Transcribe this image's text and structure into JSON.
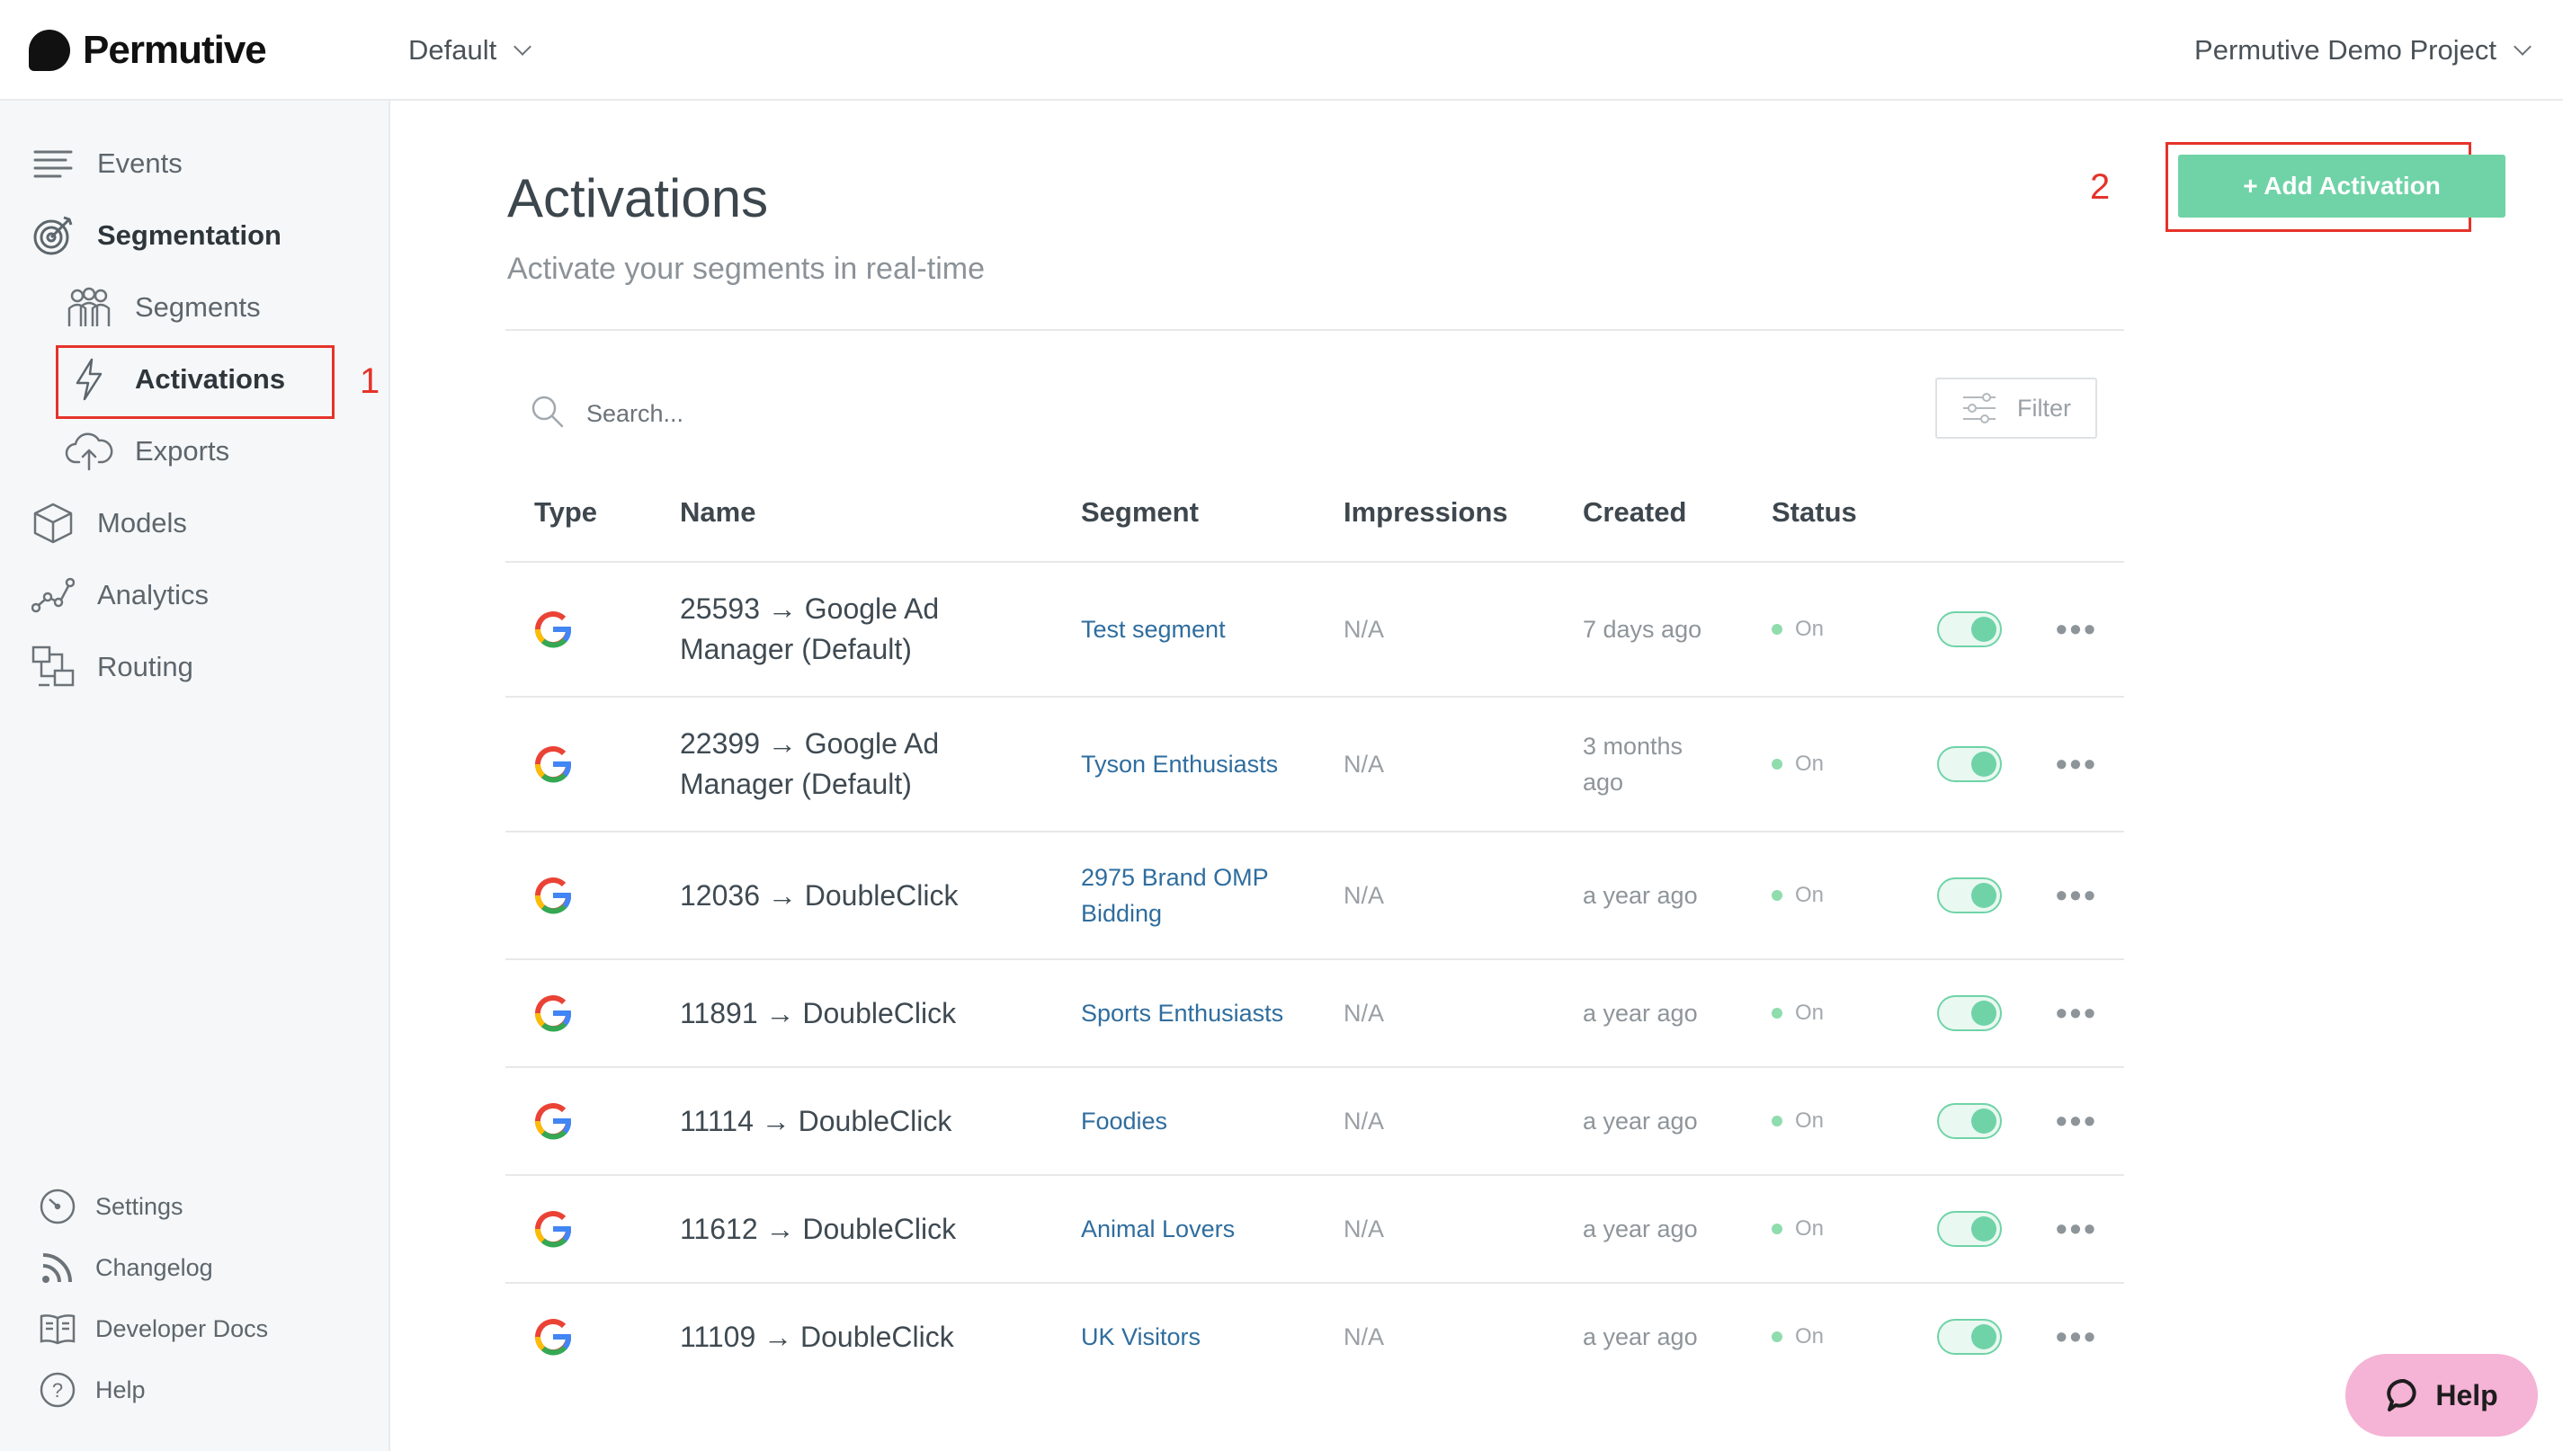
{
  "app": {
    "name": "Permutive"
  },
  "header": {
    "workspace": "Default",
    "project": "Permutive Demo Project"
  },
  "sidebar": {
    "items": [
      {
        "label": "Events",
        "icon": "events-icon"
      },
      {
        "label": "Segmentation",
        "icon": "segmentation-icon"
      },
      {
        "label": "Segments",
        "icon": "segments-icon"
      },
      {
        "label": "Activations",
        "icon": "bolt-icon"
      },
      {
        "label": "Exports",
        "icon": "cloud-upload-icon"
      },
      {
        "label": "Models",
        "icon": "cube-icon"
      },
      {
        "label": "Analytics",
        "icon": "analytics-icon"
      },
      {
        "label": "Routing",
        "icon": "routing-icon"
      }
    ],
    "bottom": [
      {
        "label": "Settings",
        "icon": "gauge-icon"
      },
      {
        "label": "Changelog",
        "icon": "rss-icon"
      },
      {
        "label": "Developer Docs",
        "icon": "book-icon"
      },
      {
        "label": "Help",
        "icon": "question-icon"
      }
    ]
  },
  "annotations": {
    "one": "1",
    "two": "2"
  },
  "page": {
    "title": "Activations",
    "subtitle": "Activate your segments in real-time",
    "add_button": "+ Add Activation",
    "search_placeholder": "Search...",
    "filter_label": "Filter"
  },
  "table": {
    "headers": [
      "Type",
      "Name",
      "Segment",
      "Impressions",
      "Created",
      "Status"
    ],
    "rows": [
      {
        "name": "25593 → Google Ad Manager (Default)",
        "segment": "Test segment",
        "impressions": "N/A",
        "created": "7 days ago",
        "status": "On"
      },
      {
        "name": "22399 → Google Ad Manager (Default)",
        "segment": "Tyson Enthusiasts",
        "impressions": "N/A",
        "created": "3 months ago",
        "status": "On"
      },
      {
        "name": "12036 → DoubleClick",
        "segment": "2975 Brand OMP Bidding",
        "impressions": "N/A",
        "created": "a year ago",
        "status": "On"
      },
      {
        "name": "11891 → DoubleClick",
        "segment": "Sports Enthusiasts",
        "impressions": "N/A",
        "created": "a year ago",
        "status": "On"
      },
      {
        "name": "11114 → DoubleClick",
        "segment": "Foodies",
        "impressions": "N/A",
        "created": "a year ago",
        "status": "On"
      },
      {
        "name": "11612 → DoubleClick",
        "segment": "Animal Lovers",
        "impressions": "N/A",
        "created": "a year ago",
        "status": "On"
      },
      {
        "name": "11109 → DoubleClick",
        "segment": "UK Visitors",
        "impressions": "N/A",
        "created": "a year ago",
        "status": "On"
      }
    ]
  },
  "help_widget": {
    "label": "Help"
  },
  "colors": {
    "accent": "#6fd3a7",
    "link": "#2f6d9e",
    "annotation": "#e5332a",
    "help": "#f5b3d6"
  }
}
